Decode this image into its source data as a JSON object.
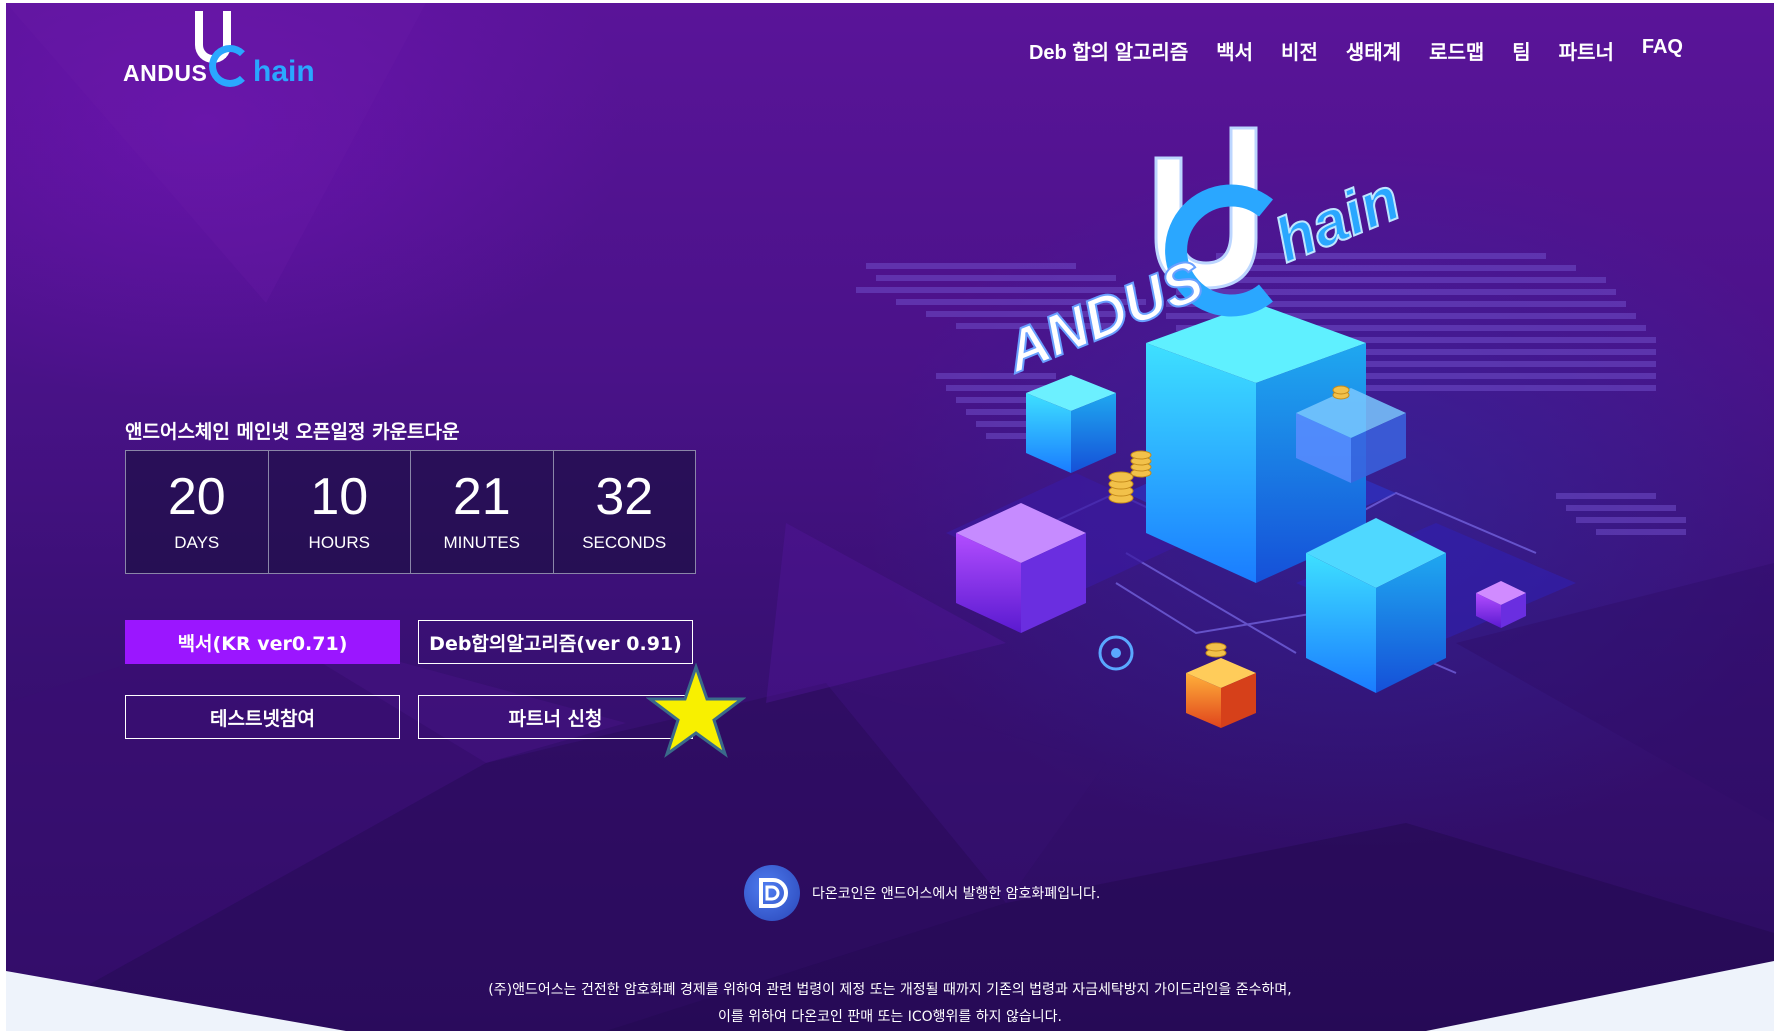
{
  "logo": {
    "text_left": "ANDUS",
    "text_right": "hain"
  },
  "nav": {
    "items": [
      "Deb 합의 알고리즘",
      "백서",
      "비전",
      "생태계",
      "로드맵",
      "팀",
      "파트너",
      "FAQ"
    ]
  },
  "countdown": {
    "label": "앤드어스체인 메인넷 오픈일정 카운트다운",
    "days": "20",
    "days_label": "DAYS",
    "hours": "10",
    "hours_label": "HOURS",
    "minutes": "21",
    "minutes_label": "MINUTES",
    "seconds": "32",
    "seconds_label": "SECONDS"
  },
  "buttons": {
    "whitepaper": "백서(KR ver0.71)",
    "deb_algorithm": "Deb합의알고리즘(ver 0.91)",
    "testnet": "테스트넷참여",
    "partner_apply": "파트너 신청"
  },
  "illustration": {
    "brand_left": "ANDUS",
    "brand_right": "hain"
  },
  "coin_note": {
    "text": "다온코인은 앤드어스에서 발행한 암호화폐입니다."
  },
  "disclaimer": {
    "line1": "(주)앤드어스는 건전한 암호화폐 경제를 위하여 관련 법령이 제정 또는 개정될 때까지 기존의 법령과 자금세탁방지 가이드라인을 준수하며,",
    "line2": "이를 위하여 다온코인 판매 또는 ICO행위를 하지 않습니다."
  },
  "colors": {
    "primary_button": "#9b16ff",
    "accent_blue": "#2aa7ff",
    "star": "#f8f000"
  }
}
